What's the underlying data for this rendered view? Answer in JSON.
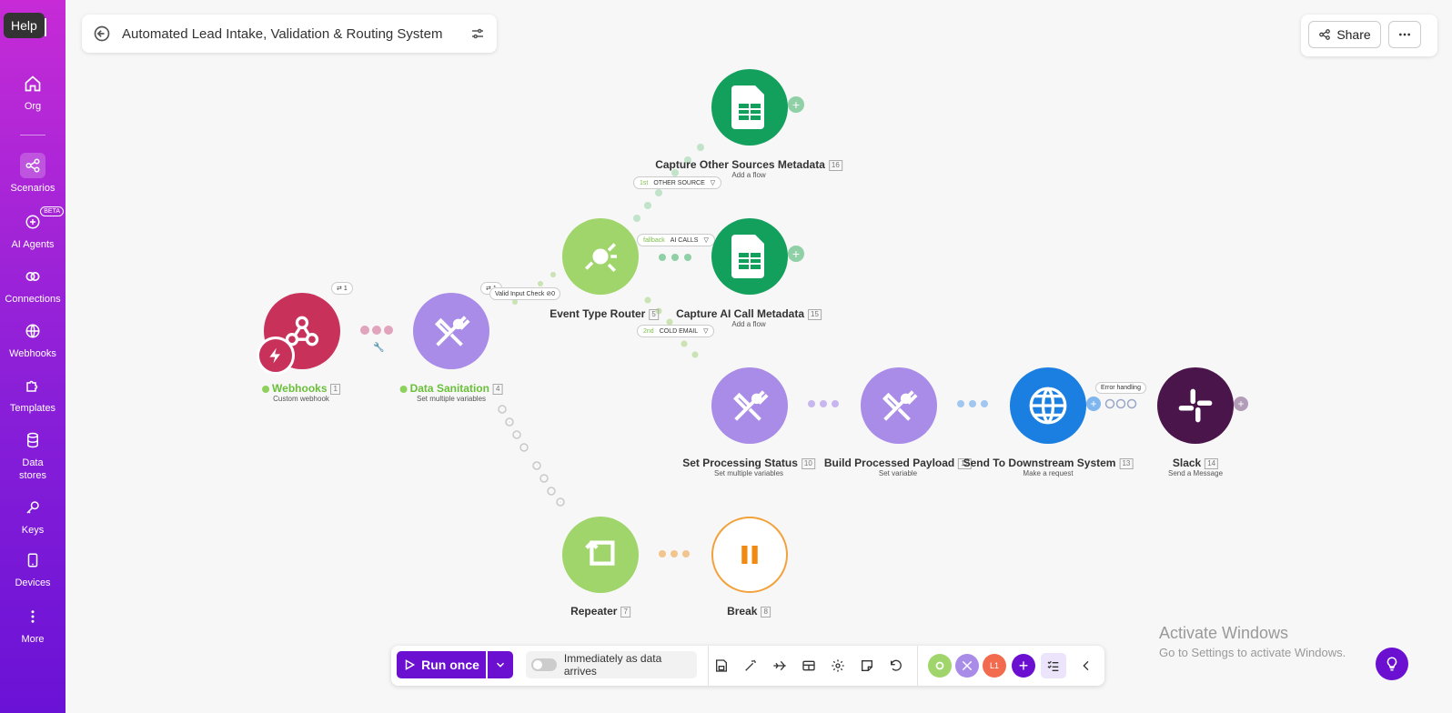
{
  "sidebar": {
    "help": "Help",
    "items": [
      {
        "label": "Org",
        "icon": "home-icon"
      },
      {
        "label": "Scenarios",
        "icon": "share-nodes-icon"
      },
      {
        "label": "AI Agents",
        "icon": "ai-agent-icon",
        "badge": "BETA"
      },
      {
        "label": "Connections",
        "icon": "link-icon"
      },
      {
        "label": "Webhooks",
        "icon": "globe-icon"
      },
      {
        "label": "Templates",
        "icon": "puzzle-icon"
      },
      {
        "label": "Data",
        "label2": "stores",
        "icon": "database-icon"
      },
      {
        "label": "Keys",
        "icon": "key-icon"
      },
      {
        "label": "Devices",
        "icon": "phone-icon"
      },
      {
        "label": "More",
        "icon": "dots-vertical-icon"
      }
    ]
  },
  "header": {
    "title": "Automated Lead Intake, Validation & Routing System",
    "share": "Share"
  },
  "nodes": {
    "webhooks": {
      "label": "Webhooks",
      "num": "1",
      "sub": "Custom webhook",
      "badge": "1"
    },
    "sanitation": {
      "label": "Data Sanitation",
      "num": "4",
      "sub": "Set multiple variables"
    },
    "router": {
      "label": "Event Type Router",
      "num": "5"
    },
    "other_meta": {
      "label": "Capture Other Sources Metadata",
      "num": "16",
      "sub": "Add a flow"
    },
    "ai_meta": {
      "label": "Capture AI Call Metadata",
      "num": "15",
      "sub": "Add a flow"
    },
    "proc_status": {
      "label": "Set Processing Status",
      "num": "10",
      "sub": "Set multiple variables"
    },
    "payload": {
      "label": "Build Processed Payload",
      "num": "12",
      "sub": "Set variable"
    },
    "downstream": {
      "label": "Send To Downstream System",
      "num": "13",
      "sub": "Make a request"
    },
    "slack": {
      "label": "Slack",
      "num": "14",
      "sub": "Send a Message"
    },
    "repeater": {
      "label": "Repeater",
      "num": "7"
    },
    "break": {
      "label": "Break",
      "num": "8"
    }
  },
  "filters": {
    "other": {
      "ord": "1st",
      "name": "OTHER SOURCE"
    },
    "ai": {
      "ord": "fallback",
      "name": "AI CALLS"
    },
    "cold": {
      "ord": "2nd",
      "name": "COLD EMAIL"
    },
    "valid": {
      "name": "Valid Input Check",
      "count": "0"
    },
    "error": "Error handling",
    "link_badge": "1"
  },
  "toolbar": {
    "run_once": "Run once",
    "schedule": "Immediately as data arrives",
    "avatar_label": "L1"
  },
  "watermark": {
    "line1": "Activate Windows",
    "line2": "Go to Settings to activate Windows."
  },
  "colors": {
    "webhook": "#c8325a",
    "tools": "#a98be8",
    "router": "#9fd56a",
    "sheets": "#12a05c",
    "http": "#1a7fe0",
    "slack": "#4a154b",
    "brand": "#6b0fd1"
  }
}
